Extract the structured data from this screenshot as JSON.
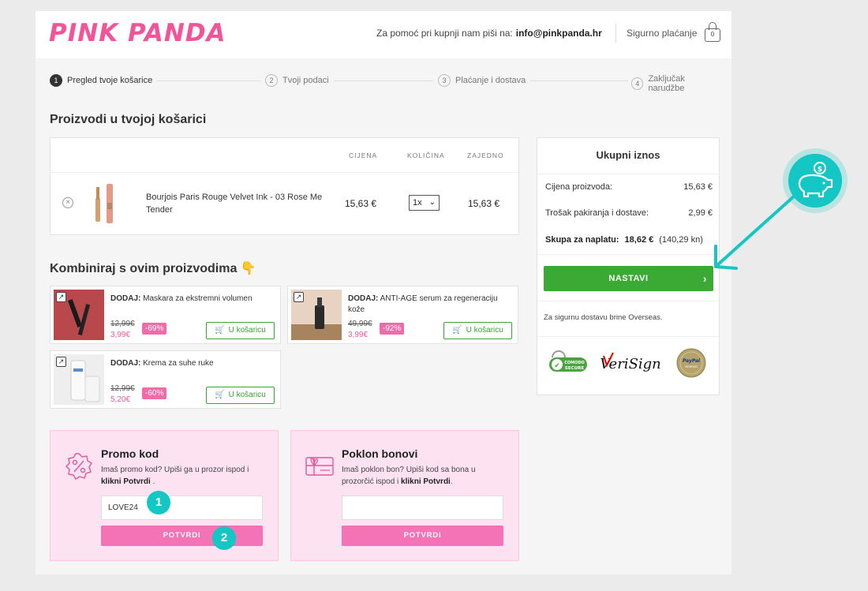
{
  "header": {
    "logo": "PINK PANDA",
    "help_text": "Za pomoć pri kupnji nam piši na:",
    "help_email": "info@pinkpanda.hr",
    "secure_text": "Sigurno plaćanje",
    "bag_count": "0"
  },
  "steps": [
    {
      "num": "1",
      "label": "Pregled tvoje košarice"
    },
    {
      "num": "2",
      "label": "Tvoji podaci"
    },
    {
      "num": "3",
      "label": "Plaćanje i dostava"
    },
    {
      "num": "4",
      "label": "Zaključak narudžbe"
    }
  ],
  "cart": {
    "title": "Proizvodi u tvojoj košarici",
    "col_price": "CIJENA",
    "col_qty": "KOLIČINA",
    "col_total": "ZAJEDNO",
    "item": {
      "name": "Bourjois Paris Rouge Velvet Ink - 03 Rose Me Tender",
      "price": "15,63 €",
      "qty": "1x",
      "total": "15,63 €"
    }
  },
  "combo": {
    "title": "Kombiniraj s ovim proizvodima 👇",
    "add_prefix": "DODAJ:",
    "add_label": "U košaricu",
    "items": [
      {
        "name": "Maskara za ekstremni volumen",
        "old": "12,99€",
        "new": "3,99€",
        "disc": "-69%"
      },
      {
        "name": "ANTI-AGE serum za regeneraciju kože",
        "old": "49,99€",
        "new": "3,99€",
        "disc": "-92%"
      },
      {
        "name": "Krema za suhe ruke",
        "old": "12,99€",
        "new": "5,20€",
        "disc": "-60%"
      }
    ]
  },
  "promo": {
    "title": "Promo kod",
    "desc": "Imaš promo kod? Upiši ga u prozor ispod i",
    "desc_bold": "klikni Potvrdi",
    "desc_end": ".",
    "value": "LOVE24",
    "button": "POTVRDI"
  },
  "voucher": {
    "title": "Poklon bonovi",
    "desc": "Imaš poklon bon? Upiši kod sa bona u prozorčić ispod i",
    "desc_bold": "klikni Potvrdi",
    "desc_end": ".",
    "value": "",
    "button": "POTVRDI"
  },
  "summary": {
    "title": "Ukupni iznos",
    "products_label": "Cijena proizvoda:",
    "products_value": "15,63 €",
    "shipping_label": "Trošak pakiranja i dostave:",
    "shipping_value": "2,99 €",
    "total_label": "Skupa za naplatu:",
    "total_value": "18,62 €",
    "total_kn": "(140,29 kn)",
    "continue": "NASTAVI",
    "ship_note": "Za sigurnu dostavu brine Overseas.",
    "badges": {
      "comodo_top": "COMODO",
      "comodo_bottom": "SECURE",
      "verisign": "VeriSign",
      "paypal_top": "PayPal",
      "paypal_bottom": "VERIFIED"
    }
  },
  "annotations": {
    "one": "1",
    "two": "2"
  },
  "colors": {
    "brand_pink": "#f2549a",
    "accent_green": "#3aaa35",
    "highlight_teal": "#14c7c4",
    "promo_bg": "#fde3f1"
  }
}
